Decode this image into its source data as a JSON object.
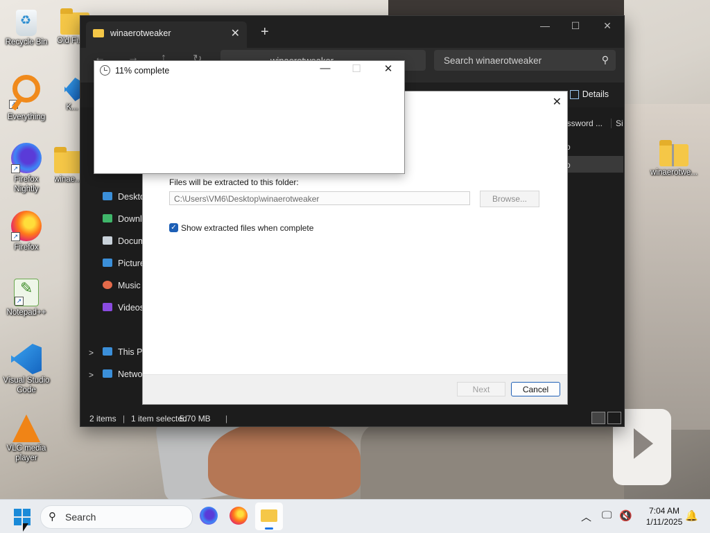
{
  "desktop": {
    "icons": [
      {
        "label": "Recycle Bin",
        "icon": "recycle-bin-icon"
      },
      {
        "label": "Old Fi... Da...",
        "icon": "folder-icon"
      },
      {
        "label": "Everything",
        "icon": "everything-icon"
      },
      {
        "label": "K...",
        "icon": "vscode-icon"
      },
      {
        "label": "Firefox Nightly",
        "icon": "firefox-nightly-icon"
      },
      {
        "label": "winae...",
        "icon": "folder-icon"
      },
      {
        "label": "Firefox",
        "icon": "firefox-icon"
      },
      {
        "label": "Notepad++",
        "icon": "notepadplusplus-icon"
      },
      {
        "label": "Visual Studio Code",
        "icon": "vscode-icon"
      },
      {
        "label": "VLC media player",
        "icon": "vlc-icon"
      },
      {
        "label": "winaerotwe...",
        "icon": "zip-folder-icon"
      }
    ]
  },
  "explorer": {
    "tab_title": "winaerotweaker",
    "tab_close": "✕",
    "new_tab": "+",
    "minimize": "—",
    "maximize": "☐",
    "close": "✕",
    "breadcrumb": "winaerotweaker",
    "search_placeholder": "Search winaerotweaker",
    "details_label": "Details",
    "columns": [
      "assword ...",
      "Si"
    ],
    "rows": [
      {
        "col1": "o"
      },
      {
        "col1": "o"
      }
    ],
    "sidebar": [
      {
        "label": "Deskto",
        "icon": "desktop-icon",
        "color": "#3b8fd9"
      },
      {
        "label": "Downlo",
        "icon": "download-icon",
        "color": "#3fb66a"
      },
      {
        "label": "Docum",
        "icon": "documents-icon",
        "color": "#c9d2da"
      },
      {
        "label": "Picture",
        "icon": "pictures-icon",
        "color": "#3b8fd9"
      },
      {
        "label": "Music",
        "icon": "music-icon",
        "color": "#e46a4a"
      },
      {
        "label": "Videos",
        "icon": "videos-icon",
        "color": "#8a4be0"
      },
      {
        "label": "This PC",
        "icon": "this-pc-icon",
        "color": "#3b8fd9"
      },
      {
        "label": "Netwo",
        "icon": "network-icon",
        "color": "#3b8fd9"
      }
    ],
    "status": {
      "items": "2 items",
      "selected": "1 item selected",
      "size": "5.70 MB"
    }
  },
  "wizard": {
    "close": "✕",
    "folder_label": "Files will be extracted to this folder:",
    "folder_path": "C:\\Users\\VM6\\Desktop\\winaerotweaker",
    "browse_label": "Browse...",
    "show_files_label": "Show extracted files when complete",
    "show_files_checked": true,
    "next_label": "Next",
    "cancel_label": "Cancel"
  },
  "progress_dialog": {
    "title": "11% complete",
    "percent": 11,
    "minimize": "—",
    "maximize": "☐",
    "close": "✕"
  },
  "taskbar": {
    "search_placeholder": "Search",
    "time": "7:04 AM",
    "date": "1/11/2025",
    "apps": [
      "firefox-nightly-icon",
      "firefox-icon",
      "file-explorer-icon"
    ],
    "tray": [
      "chevron-up-icon",
      "network-icon",
      "volume-muted-icon",
      "notification-bell-icon"
    ]
  },
  "colors": {
    "accent": "#1d5fb6",
    "explorer_bg": "#1c1c1c",
    "taskbar_bg": "#e9ecf0"
  }
}
